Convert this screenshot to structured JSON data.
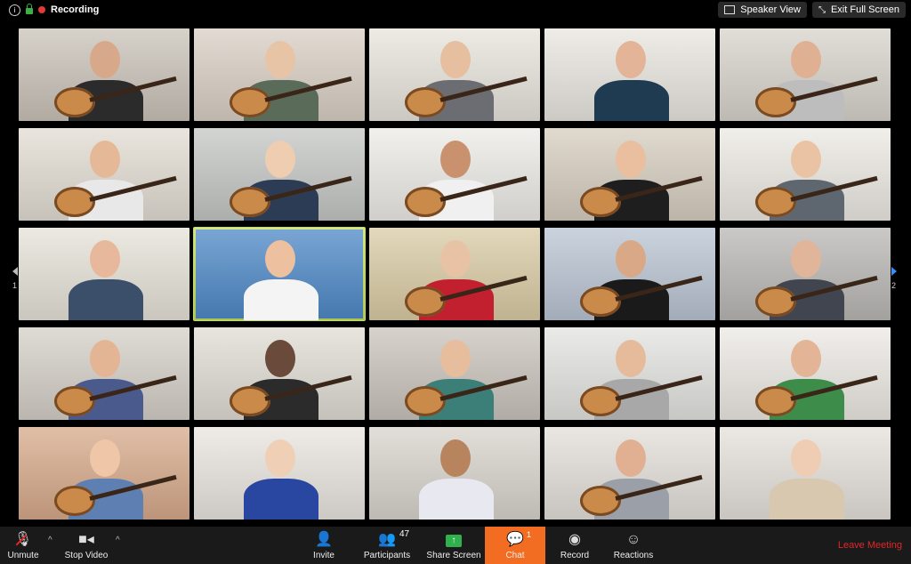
{
  "top_bar": {
    "recording_label": "Recording",
    "speaker_view_label": "Speaker View",
    "exit_fullscreen_label": "Exit Full Screen",
    "icons": [
      "info-icon",
      "lock-icon",
      "record-dot-icon",
      "grid-icon",
      "exit-fullscreen-icon"
    ]
  },
  "gallery": {
    "page_left": "1",
    "page_right": "2",
    "active_tile": 11,
    "tiles": [
      {
        "bg": "#c9c2b8",
        "skin": "#d8a88a",
        "shirt": "#2b2b2b",
        "hasGuitar": true
      },
      {
        "bg": "#d9cfc4",
        "skin": "#e8c4a6",
        "shirt": "#5b6b5a",
        "hasGuitar": true
      },
      {
        "bg": "#e8e4dc",
        "skin": "#e6bea0",
        "shirt": "#6b6d72",
        "hasGuitar": true
      },
      {
        "bg": "#e9e6e0",
        "skin": "#e3b497",
        "shirt": "#1f3b52",
        "hasGuitar": false
      },
      {
        "bg": "#d7d3cb",
        "skin": "#e0b093",
        "shirt": "#bdbdbd",
        "hasGuitar": true
      },
      {
        "bg": "#e2ddd3",
        "skin": "#e5b897",
        "shirt": "#e8e8e8",
        "hasGuitar": true
      },
      {
        "bg": "#c4c6c4",
        "skin": "#efcdb0",
        "shirt": "#2c3c55",
        "hasGuitar": true
      },
      {
        "bg": "#ecebe7",
        "skin": "#c9916e",
        "shirt": "#f0f0f0",
        "hasGuitar": true
      },
      {
        "bg": "#d6cdbf",
        "skin": "#e9bfa0",
        "shirt": "#1e1e1e",
        "hasGuitar": true
      },
      {
        "bg": "#ece9e3",
        "skin": "#eac3a4",
        "shirt": "#5e6770",
        "hasGuitar": true
      },
      {
        "bg": "#e6e2d8",
        "skin": "#e7b89b",
        "shirt": "#3b4f6a",
        "hasGuitar": false
      },
      {
        "bg": "#4d88c6",
        "skin": "#edc0a0",
        "shirt": "#f4f4f4",
        "hasGuitar": false
      },
      {
        "bg": "#d9cba4",
        "skin": "#e8c2a4",
        "shirt": "#c3202f",
        "hasGuitar": true
      },
      {
        "bg": "#b9c4d2",
        "skin": "#d9a886",
        "shirt": "#1a1a1a",
        "hasGuitar": true
      },
      {
        "bg": "#b9b7b4",
        "skin": "#e0b59a",
        "shirt": "#40454f",
        "hasGuitar": true
      },
      {
        "bg": "#d4cfc7",
        "skin": "#e4b595",
        "shirt": "#4a5a8c",
        "hasGuitar": true
      },
      {
        "bg": "#e0dcd4",
        "skin": "#6a4a3a",
        "shirt": "#2b2b2b",
        "hasGuitar": true
      },
      {
        "bg": "#c9c3bb",
        "skin": "#e6bd9d",
        "shirt": "#3c7f79",
        "hasGuitar": true
      },
      {
        "bg": "#e3e3e0",
        "skin": "#e5bb9c",
        "shirt": "#a8a8a8",
        "hasGuitar": true
      },
      {
        "bg": "#ece9e4",
        "skin": "#e3b495",
        "shirt": "#3d8c4a",
        "hasGuitar": true
      },
      {
        "bg": "#d6a98a",
        "skin": "#efc7a8",
        "shirt": "#5d7fb1",
        "hasGuitar": true
      },
      {
        "bg": "#e9e5e0",
        "skin": "#efcfb6",
        "shirt": "#2947a0",
        "hasGuitar": false
      },
      {
        "bg": "#d8d3cc",
        "skin": "#b8845e",
        "shirt": "#e8e8f0",
        "hasGuitar": false
      },
      {
        "bg": "#e3dfd9",
        "skin": "#e1b092",
        "shirt": "#9ba0a8",
        "hasGuitar": true
      },
      {
        "bg": "#e5e0da",
        "skin": "#efcdb4",
        "shirt": "#d8c8b0",
        "hasGuitar": false
      }
    ]
  },
  "toolbar": {
    "unmute_label": "Unmute",
    "stop_video_label": "Stop Video",
    "invite_label": "Invite",
    "participants_label": "Participants",
    "participants_count": "47",
    "share_screen_label": "Share Screen",
    "chat_label": "Chat",
    "chat_badge": "1",
    "record_label": "Record",
    "reactions_label": "Reactions",
    "leave_label": "Leave Meeting",
    "colors": {
      "chat_accent": "#f26d21",
      "leave": "#e02828",
      "share": "#2fb24c"
    }
  }
}
